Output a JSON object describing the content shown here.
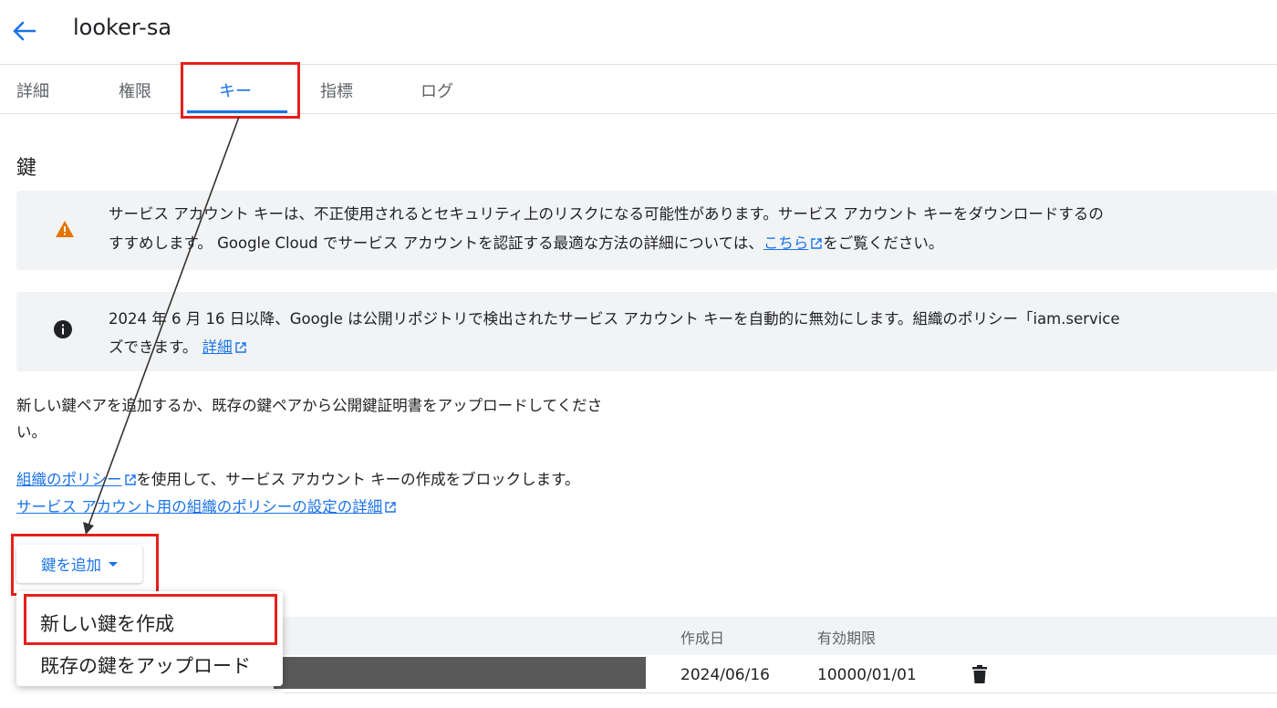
{
  "header": {
    "title": "looker-sa"
  },
  "tabs": [
    {
      "label": "詳細"
    },
    {
      "label": "権限"
    },
    {
      "label": "キー"
    },
    {
      "label": "指標"
    },
    {
      "label": "ログ"
    }
  ],
  "section": {
    "title": "鍵"
  },
  "warning_banner": {
    "line1": "サービス アカウント キーは、不正使用されるとセキュリティ上のリスクになる可能性があります。サービス アカウント キーをダウンロードするの",
    "line2_before": "すすめします。 Google Cloud でサービス アカウントを認証する最適な方法の詳細については、",
    "line2_link": "こちら",
    "line2_after": "をご覧ください。"
  },
  "info_banner": {
    "line1": "2024 年 6 月 16 日以降、Google は公開リポジトリで検出されたサービス アカウント キーを自動的に無効にします。組織のポリシー「iam.service",
    "line2_before": "ズできます。",
    "line2_link": "詳細"
  },
  "description": {
    "line1": "新しい鍵ペアを追加するか、既存の鍵ペアから公開鍵証明書をアップロードしてくださ",
    "line2": "い。"
  },
  "policy": {
    "link1": "組織のポリシー",
    "text1": "を使用して、サービス アカウント キーの作成をブロックします。",
    "link2": "サービス アカウント用の組織のポリシーの設定の詳細"
  },
  "add_key_button": {
    "label": "鍵を追加"
  },
  "dropdown_menu": {
    "items": [
      {
        "label": "新しい鍵を作成"
      },
      {
        "label": "既存の鍵をアップロード"
      }
    ]
  },
  "keys_table": {
    "columns": {
      "created": "作成日",
      "expires": "有効期限"
    },
    "rows": [
      {
        "created": "2024/06/16",
        "expires": "10000/01/01"
      }
    ]
  },
  "colors": {
    "accent": "#1a73e8",
    "highlight": "#e5201c",
    "warning": "#e37400"
  }
}
